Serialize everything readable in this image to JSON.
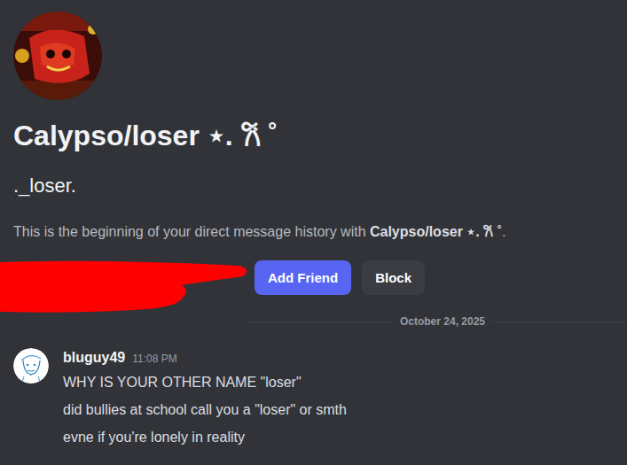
{
  "profile": {
    "display_name": "Calypso/loser ⋆. 𐙚 ˚",
    "username": "._loser."
  },
  "intro": {
    "text": "This is the beginning of your direct message history with ",
    "name": "Calypso/loser ⋆. 𐙚 ˚",
    "end": "."
  },
  "buttons": [
    {
      "label": "Add Friend",
      "kind": "primary"
    },
    {
      "label": "Block",
      "kind": "secondary"
    }
  ],
  "divider": {
    "date": "October 24, 2025"
  },
  "messages": [
    {
      "author": "bluguy49",
      "time": "11:08 PM",
      "lines": [
        "WHY IS YOUR OTHER NAME \"loser\"",
        "did bullies at school call you a \"loser\" or smth",
        "evne if you're lonely in reality"
      ]
    }
  ]
}
